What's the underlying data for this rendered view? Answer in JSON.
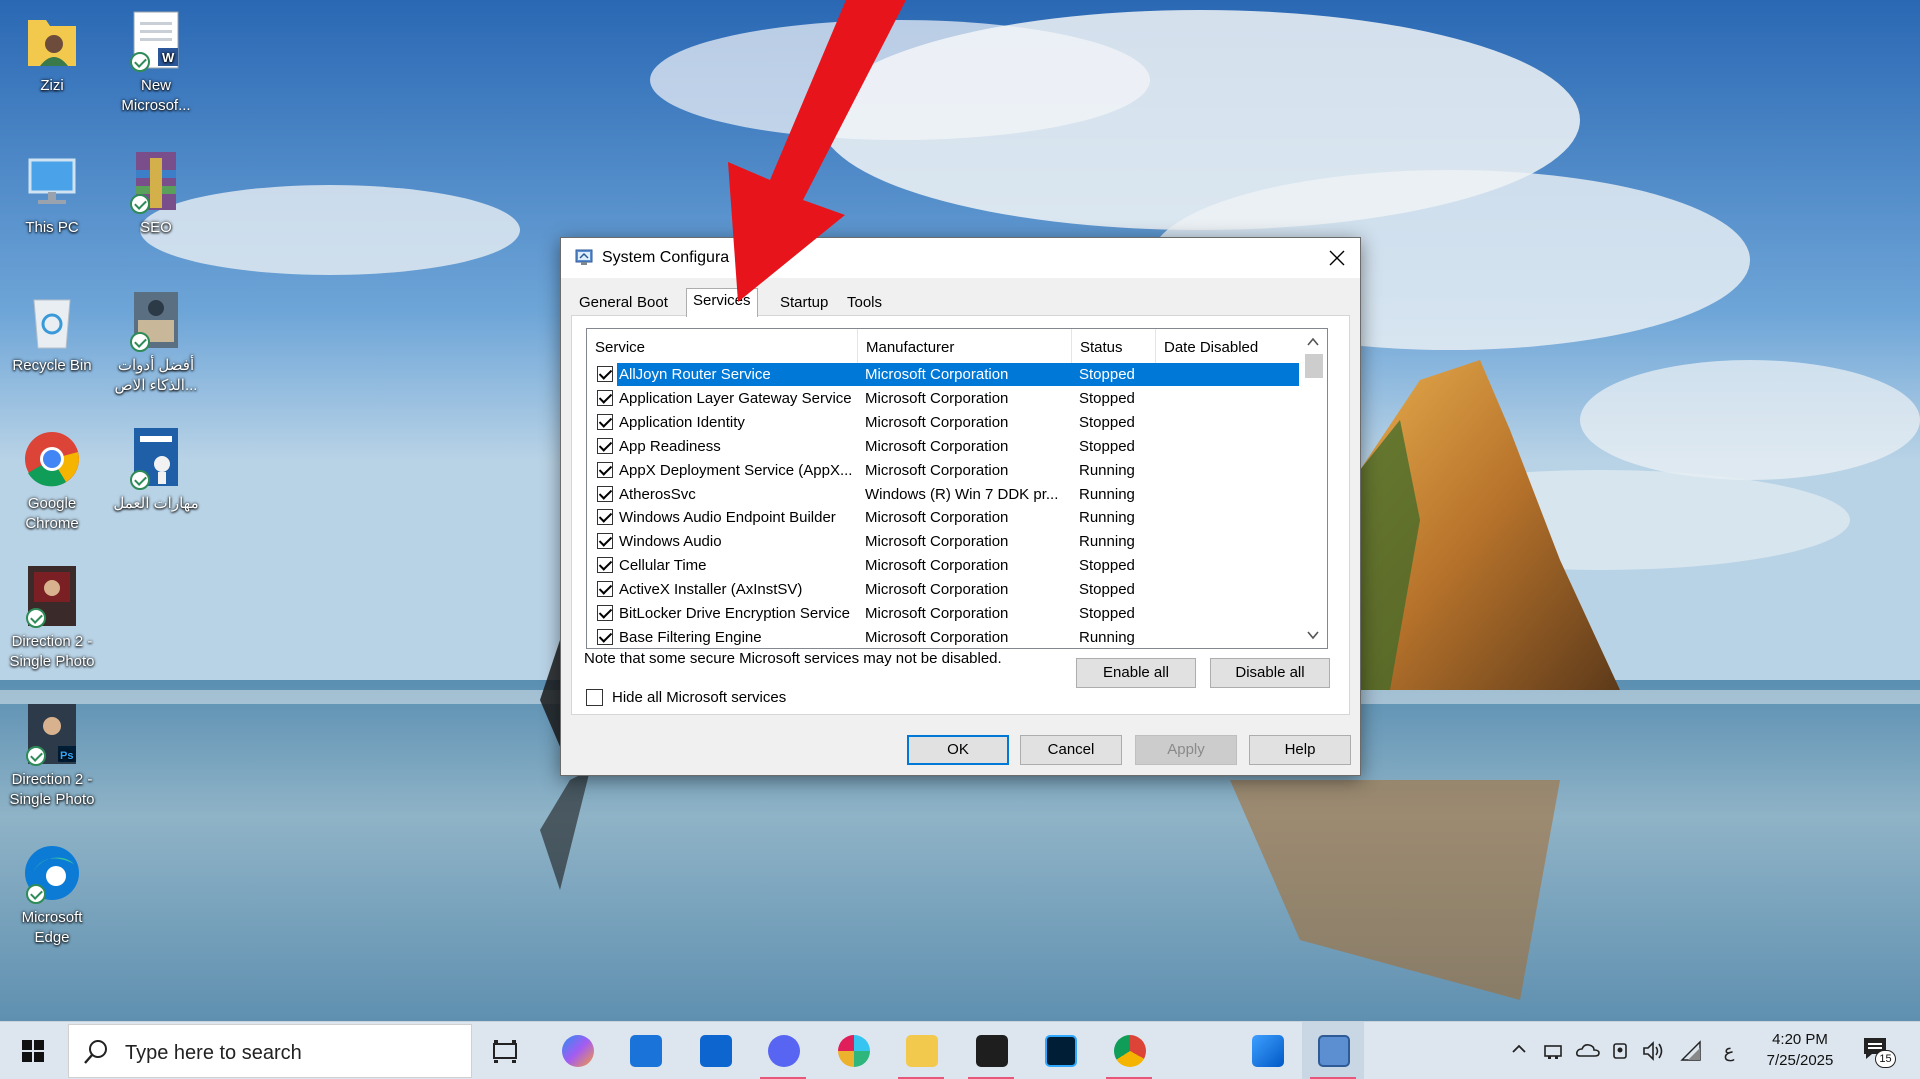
{
  "desktop": {
    "icons": [
      {
        "label": "Zizi",
        "icon": "user-folder-icon"
      },
      {
        "label": "New Microsof...",
        "icon": "word-document-icon"
      },
      {
        "label": "This PC",
        "icon": "computer-icon"
      },
      {
        "label": "SEO",
        "icon": "winrar-archive-icon"
      },
      {
        "label": "Recycle Bin",
        "icon": "recycle-bin-icon"
      },
      {
        "label": "أفضل أدوات الذكاء الاص...",
        "icon": "image-file-icon"
      },
      {
        "label": "Google Chrome",
        "icon": "chrome-icon"
      },
      {
        "label": "مهارات العمل",
        "icon": "book-cover-icon"
      },
      {
        "label": "Direction 2 - Single Photo",
        "icon": "photo-file-icon"
      },
      {
        "label": "Direction 2 - Single Photo",
        "icon": "photoshop-file-icon"
      },
      {
        "label": "Microsoft Edge",
        "icon": "edge-icon"
      }
    ]
  },
  "dialog": {
    "title": "System Configura",
    "close_icon": "close-icon",
    "tabs": [
      "General",
      "Boot",
      "Services",
      "Startup",
      "Tools"
    ],
    "active_tab": "Services",
    "columns": [
      "Service",
      "Manufacturer",
      "Status",
      "Date Disabled"
    ],
    "services": [
      {
        "name": "AllJoyn Router Service",
        "manufacturer": "Microsoft Corporation",
        "status": "Stopped",
        "date_disabled": "",
        "checked": true,
        "selected": true
      },
      {
        "name": "Application Layer Gateway Service",
        "manufacturer": "Microsoft Corporation",
        "status": "Stopped",
        "date_disabled": "",
        "checked": true
      },
      {
        "name": "Application Identity",
        "manufacturer": "Microsoft Corporation",
        "status": "Stopped",
        "date_disabled": "",
        "checked": true
      },
      {
        "name": "App Readiness",
        "manufacturer": "Microsoft Corporation",
        "status": "Stopped",
        "date_disabled": "",
        "checked": true
      },
      {
        "name": "AppX Deployment Service (AppX...",
        "manufacturer": "Microsoft Corporation",
        "status": "Running",
        "date_disabled": "",
        "checked": true
      },
      {
        "name": "AtherosSvc",
        "manufacturer": "Windows (R) Win 7 DDK pr...",
        "status": "Running",
        "date_disabled": "",
        "checked": true
      },
      {
        "name": "Windows Audio Endpoint Builder",
        "manufacturer": "Microsoft Corporation",
        "status": "Running",
        "date_disabled": "",
        "checked": true
      },
      {
        "name": "Windows Audio",
        "manufacturer": "Microsoft Corporation",
        "status": "Running",
        "date_disabled": "",
        "checked": true
      },
      {
        "name": "Cellular Time",
        "manufacturer": "Microsoft Corporation",
        "status": "Stopped",
        "date_disabled": "",
        "checked": true
      },
      {
        "name": "ActiveX Installer (AxInstSV)",
        "manufacturer": "Microsoft Corporation",
        "status": "Stopped",
        "date_disabled": "",
        "checked": true
      },
      {
        "name": "BitLocker Drive Encryption Service",
        "manufacturer": "Microsoft Corporation",
        "status": "Stopped",
        "date_disabled": "",
        "checked": true
      },
      {
        "name": "Base Filtering Engine",
        "manufacturer": "Microsoft Corporation",
        "status": "Running",
        "date_disabled": "",
        "checked": true
      }
    ],
    "note": "Note that some secure Microsoft services may not be disabled.",
    "enable_all": "Enable all",
    "disable_all": "Disable all",
    "hide_ms_label": "Hide all Microsoft services",
    "hide_ms_checked": false,
    "ok": "OK",
    "cancel": "Cancel",
    "apply": "Apply",
    "help": "Help"
  },
  "taskbar": {
    "search_placeholder": "Type here to search",
    "apps": [
      "task-view-icon",
      "copilot-icon",
      "microsoft-store-icon",
      "trello-icon",
      "discord-icon",
      "slack-icon",
      "file-explorer-icon",
      "obs-icon",
      "photoshop-icon",
      "chrome-icon",
      "photos-icon",
      "system-config-icon"
    ],
    "tray_icons": [
      "chevron-up-icon",
      "network-adapter-icon",
      "onedrive-icon",
      "meet-now-icon",
      "volume-icon",
      "wifi-icon"
    ],
    "input_lang": "ع",
    "time": "4:20 PM",
    "date": "7/25/2025",
    "notification_count": "15"
  },
  "colors": {
    "accent": "#0078d7",
    "annotation_arrow": "#e8141b"
  }
}
